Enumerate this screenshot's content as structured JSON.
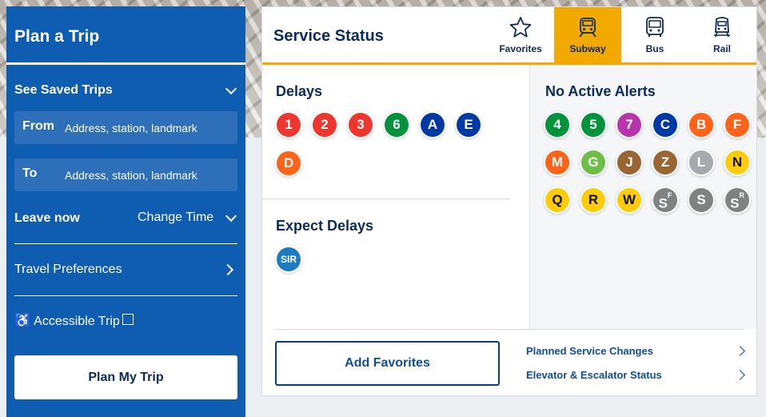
{
  "plan_trip": {
    "title": "Plan a Trip",
    "saved_trips_label": "See Saved Trips",
    "from_label": "From",
    "from_placeholder": "Address, station, landmark",
    "to_label": "To",
    "to_placeholder": "Address, station, landmark",
    "leave_label": "Leave now",
    "change_time_label": "Change Time",
    "travel_prefs_label": "Travel Preferences",
    "accessible_label": "Accessible Trip",
    "accessible_checked": false,
    "plan_button_label": "Plan My Trip",
    "panel_color": "#0f5db0"
  },
  "service_status": {
    "title": "Service Status",
    "tabs": [
      {
        "label": "Favorites",
        "icon": "star-icon",
        "active": false
      },
      {
        "label": "Subway",
        "icon": "subway-icon",
        "active": true
      },
      {
        "label": "Bus",
        "icon": "bus-icon",
        "active": false
      },
      {
        "label": "Rail",
        "icon": "rail-icon",
        "active": false
      }
    ],
    "accent_color": "#f2a900",
    "delays": {
      "title": "Delays",
      "lines": [
        {
          "label": "1",
          "color": "#ee352e"
        },
        {
          "label": "2",
          "color": "#ee352e"
        },
        {
          "label": "3",
          "color": "#ee352e"
        },
        {
          "label": "6",
          "color": "#00933c"
        },
        {
          "label": "A",
          "color": "#0039a6"
        },
        {
          "label": "E",
          "color": "#0039a6"
        },
        {
          "label": "D",
          "color": "#ff6319"
        }
      ]
    },
    "expect_delays": {
      "title": "Expect Delays",
      "lines": [
        {
          "label": "SIR",
          "color": "#1d7bc2"
        }
      ]
    },
    "no_alerts": {
      "title": "No Active Alerts",
      "lines": [
        {
          "label": "4",
          "color": "#00933c"
        },
        {
          "label": "5",
          "color": "#00933c"
        },
        {
          "label": "7",
          "color": "#b933ad"
        },
        {
          "label": "C",
          "color": "#0039a6"
        },
        {
          "label": "B",
          "color": "#ff6319"
        },
        {
          "label": "F",
          "color": "#ff6319"
        },
        {
          "label": "M",
          "color": "#ff6319"
        },
        {
          "label": "G",
          "color": "#6cbe45"
        },
        {
          "label": "J",
          "color": "#996633"
        },
        {
          "label": "Z",
          "color": "#996633"
        },
        {
          "label": "L",
          "color": "#a7a9ac"
        },
        {
          "label": "N",
          "color": "#fccc0a"
        },
        {
          "label": "Q",
          "color": "#fccc0a"
        },
        {
          "label": "R",
          "color": "#fccc0a"
        },
        {
          "label": "W",
          "color": "#fccc0a"
        },
        {
          "label": "S",
          "sup": "F",
          "color": "#808183"
        },
        {
          "label": "S",
          "color": "#808183"
        },
        {
          "label": "S",
          "sup": "R",
          "color": "#808183"
        }
      ]
    },
    "add_favorites_label": "Add Favorites",
    "links": [
      "Planned Service Changes",
      "Elevator & Escalator Status"
    ]
  }
}
